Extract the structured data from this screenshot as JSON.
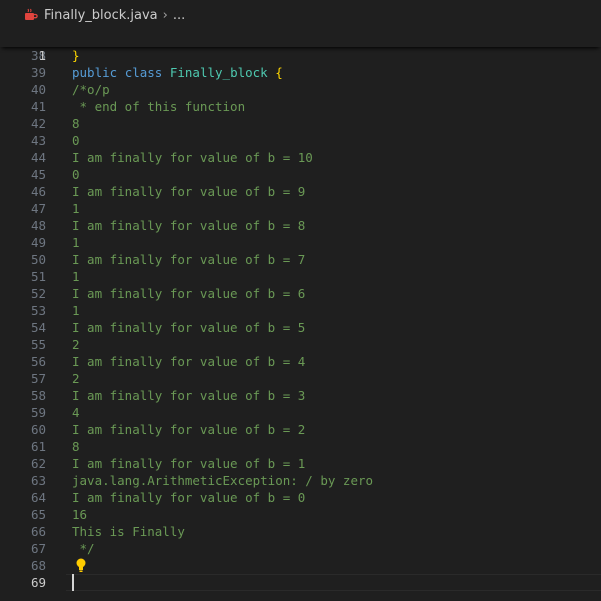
{
  "breadcrumb": {
    "file_icon": "java-file-icon",
    "file_name": "Finally_block.java",
    "separator": "›",
    "more": "..."
  },
  "sticky_line": {
    "number": "1",
    "keyword1": "public",
    "keyword2": "class",
    "class_name": "Finally_block",
    "brace": "{"
  },
  "lines": [
    {
      "n": "38",
      "text": "}",
      "kind": "brace"
    },
    {
      "n": "39",
      "text": "",
      "kind": "plain"
    },
    {
      "n": "40",
      "text": "/*o/p",
      "kind": "cmt"
    },
    {
      "n": "41",
      "text": " * end of this function",
      "kind": "cmt"
    },
    {
      "n": "42",
      "text": "8",
      "kind": "cmt"
    },
    {
      "n": "43",
      "text": "0",
      "kind": "cmt"
    },
    {
      "n": "44",
      "text": "I am finally for value of b = 10",
      "kind": "cmt"
    },
    {
      "n": "45",
      "text": "0",
      "kind": "cmt"
    },
    {
      "n": "46",
      "text": "I am finally for value of b = 9",
      "kind": "cmt"
    },
    {
      "n": "47",
      "text": "1",
      "kind": "cmt"
    },
    {
      "n": "48",
      "text": "I am finally for value of b = 8",
      "kind": "cmt"
    },
    {
      "n": "49",
      "text": "1",
      "kind": "cmt"
    },
    {
      "n": "50",
      "text": "I am finally for value of b = 7",
      "kind": "cmt"
    },
    {
      "n": "51",
      "text": "1",
      "kind": "cmt"
    },
    {
      "n": "52",
      "text": "I am finally for value of b = 6",
      "kind": "cmt"
    },
    {
      "n": "53",
      "text": "1",
      "kind": "cmt"
    },
    {
      "n": "54",
      "text": "I am finally for value of b = 5",
      "kind": "cmt"
    },
    {
      "n": "55",
      "text": "2",
      "kind": "cmt"
    },
    {
      "n": "56",
      "text": "I am finally for value of b = 4",
      "kind": "cmt"
    },
    {
      "n": "57",
      "text": "2",
      "kind": "cmt"
    },
    {
      "n": "58",
      "text": "I am finally for value of b = 3",
      "kind": "cmt"
    },
    {
      "n": "59",
      "text": "4",
      "kind": "cmt"
    },
    {
      "n": "60",
      "text": "I am finally for value of b = 2",
      "kind": "cmt"
    },
    {
      "n": "61",
      "text": "8",
      "kind": "cmt"
    },
    {
      "n": "62",
      "text": "I am finally for value of b = 1",
      "kind": "cmt"
    },
    {
      "n": "63",
      "text": "java.lang.ArithmeticException: / by zero",
      "kind": "cmt"
    },
    {
      "n": "64",
      "text": "I am finally for value of b = 0",
      "kind": "cmt"
    },
    {
      "n": "65",
      "text": "16",
      "kind": "cmt"
    },
    {
      "n": "66",
      "text": "This is Finally",
      "kind": "cmt"
    },
    {
      "n": "67",
      "text": " */",
      "kind": "cmt"
    },
    {
      "n": "68",
      "text": "",
      "kind": "plain"
    },
    {
      "n": "69",
      "text": "",
      "kind": "plain",
      "active": true
    }
  ],
  "colors": {
    "background": "#1f1f1f",
    "keyword": "#569cd6",
    "class_name": "#4ec9b0",
    "brace": "#ffd700",
    "comment": "#6a9955",
    "line_number": "#6e7681",
    "active_line_number": "#cccccc",
    "java_icon": "#e0443e",
    "lightbulb": "#ffcc00"
  },
  "icons": {
    "lightbulb": "lightbulb-icon"
  }
}
